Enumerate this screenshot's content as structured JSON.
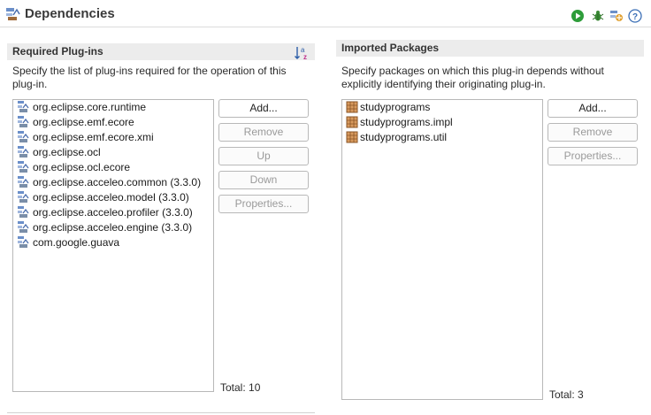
{
  "header": {
    "title": "Dependencies",
    "toolbar_icons": [
      "run-icon",
      "debug-icon",
      "pde-icon",
      "help-icon"
    ]
  },
  "required": {
    "title": "Required Plug-ins",
    "sort_icon": "sort-alphabetical-icon",
    "description_line1": "Specify the list of plug-ins required for the operation of this",
    "description_line2": "plug-in.",
    "items": [
      "org.eclipse.core.runtime",
      "org.eclipse.emf.ecore",
      "org.eclipse.emf.ecore.xmi",
      "org.eclipse.ocl",
      "org.eclipse.ocl.ecore",
      "org.eclipse.acceleo.common (3.3.0)",
      "org.eclipse.acceleo.model (3.3.0)",
      "org.eclipse.acceleo.profiler (3.3.0)",
      "org.eclipse.acceleo.engine (3.3.0)",
      "com.google.guava"
    ],
    "buttons": {
      "add": "Add...",
      "remove": "Remove",
      "up": "Up",
      "down": "Down",
      "properties": "Properties..."
    },
    "total": "Total: 10"
  },
  "imported": {
    "title": "Imported Packages",
    "description_line1": "Specify packages on which this plug-in depends without",
    "description_line2": "explicitly identifying their originating plug-in.",
    "items": [
      "studyprograms",
      "studyprograms.impl",
      "studyprograms.util"
    ],
    "buttons": {
      "add": "Add...",
      "remove": "Remove",
      "properties": "Properties..."
    },
    "total": "Total: 3"
  },
  "colors": {
    "section_bar": "#ececec",
    "run_green": "#2e9d3a",
    "help_blue": "#3b6fb6",
    "package_brown": "#b9773f"
  }
}
